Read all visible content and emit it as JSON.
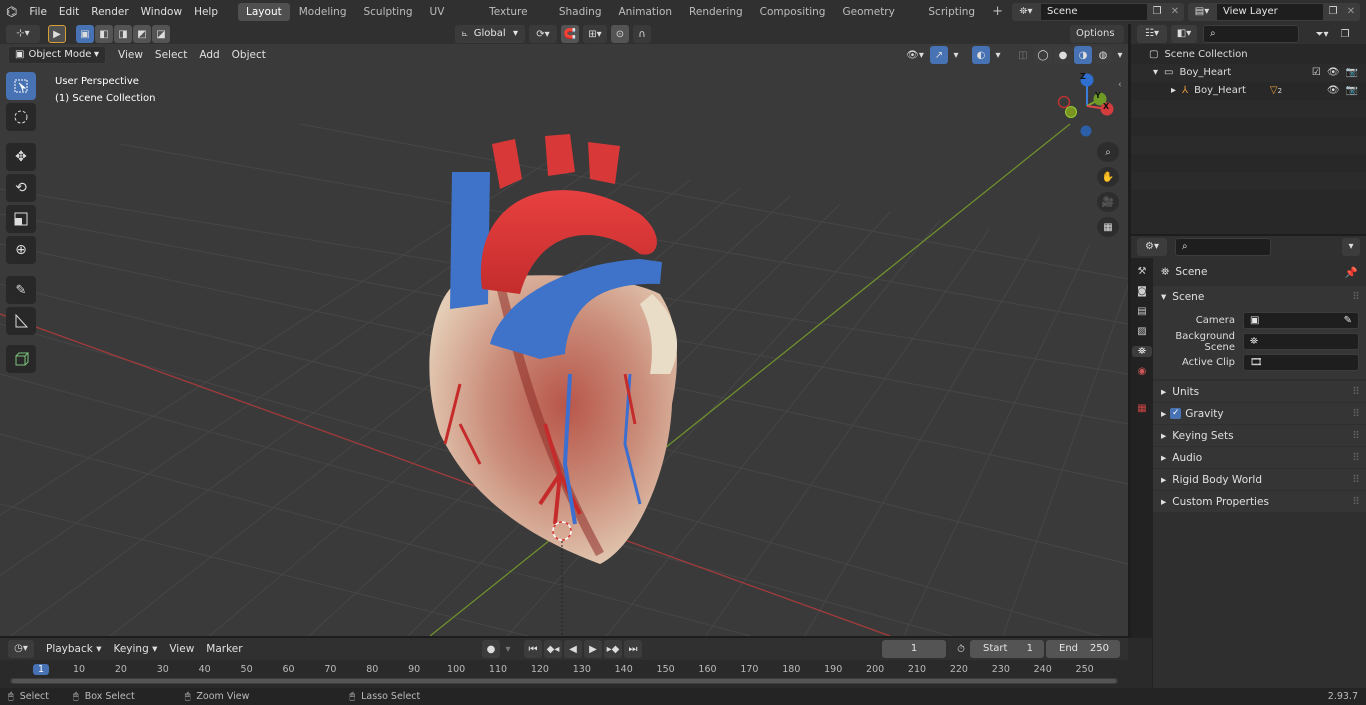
{
  "menu": [
    "File",
    "Edit",
    "Render",
    "Window",
    "Help"
  ],
  "workspaces": [
    "Layout",
    "Modeling",
    "Sculpting",
    "UV Editing",
    "Texture Paint",
    "Shading",
    "Animation",
    "Rendering",
    "Compositing",
    "Geometry Nodes",
    "Scripting"
  ],
  "active_workspace": "Layout",
  "scene_field": "Scene",
  "view_layer_field": "View Layer",
  "viewport_header": {
    "mode": "Object Mode",
    "menus": [
      "View",
      "Select",
      "Add",
      "Object"
    ],
    "orientation": "Global",
    "options": "Options"
  },
  "viewport_overlay": {
    "perspective": "User Perspective",
    "collection": "(1) Scene Collection"
  },
  "gizmo": {
    "z": "Z",
    "y": "Y",
    "x": "X"
  },
  "outliner": {
    "root": "Scene Collection",
    "items": [
      {
        "label": "Boy_Heart",
        "level": 1
      },
      {
        "label": "Boy_Heart",
        "level": 2,
        "badge": "2"
      }
    ]
  },
  "properties": {
    "context": "Scene",
    "panel": "Scene",
    "fields": [
      {
        "label": "Camera",
        "value": ""
      },
      {
        "label": "Background Scene",
        "value": ""
      },
      {
        "label": "Active Clip",
        "value": ""
      }
    ],
    "subpanels": [
      "Units",
      "Gravity",
      "Keying Sets",
      "Audio",
      "Rigid Body World",
      "Custom Properties"
    ],
    "gravity_checked": true
  },
  "timeline": {
    "menus": [
      "Playback",
      "Keying",
      "View",
      "Marker"
    ],
    "current_frame": "1",
    "start_label": "Start",
    "start_value": "1",
    "end_label": "End",
    "end_value": "250",
    "ruler": [
      "1",
      "10",
      "20",
      "30",
      "40",
      "50",
      "60",
      "70",
      "80",
      "90",
      "100",
      "110",
      "120",
      "130",
      "140",
      "150",
      "160",
      "170",
      "180",
      "190",
      "200",
      "210",
      "220",
      "230",
      "240",
      "250"
    ]
  },
  "status": {
    "items": [
      "Select",
      "Box Select",
      "Zoom View",
      "Lasso Select"
    ],
    "version": "2.93.7"
  },
  "colors": {
    "accent": "#4772b3",
    "x_axis": "#c04040",
    "y_axis": "#7aa52f",
    "z_axis": "#2f6fd0"
  }
}
